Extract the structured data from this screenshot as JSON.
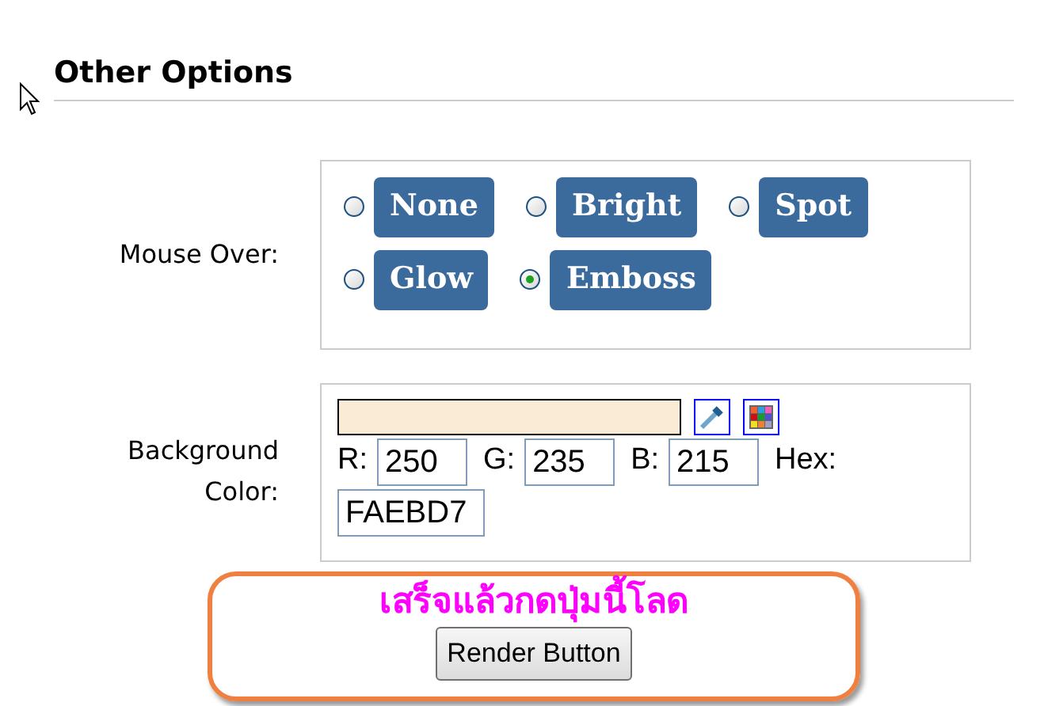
{
  "section_title": "Other Options",
  "mouse_over": {
    "label": "Mouse Over:",
    "rows": [
      {
        "options": [
          {
            "label": "None",
            "selected": false
          },
          {
            "label": "Bright",
            "selected": false
          },
          {
            "label": "Spot",
            "selected": false
          }
        ]
      },
      {
        "options": [
          {
            "label": "Glow",
            "selected": false
          },
          {
            "label": "Emboss",
            "selected": true
          }
        ]
      }
    ]
  },
  "background_color": {
    "label": "Background Color:",
    "r_label": "R:",
    "r": "250",
    "g_label": "G:",
    "g": "235",
    "b_label": "B:",
    "b": "215",
    "hex_label": "Hex:",
    "hex": "FAEBD7"
  },
  "note": "เสร็จแล้วกดปุ่มนี้โลด",
  "render_button": "Render Button"
}
